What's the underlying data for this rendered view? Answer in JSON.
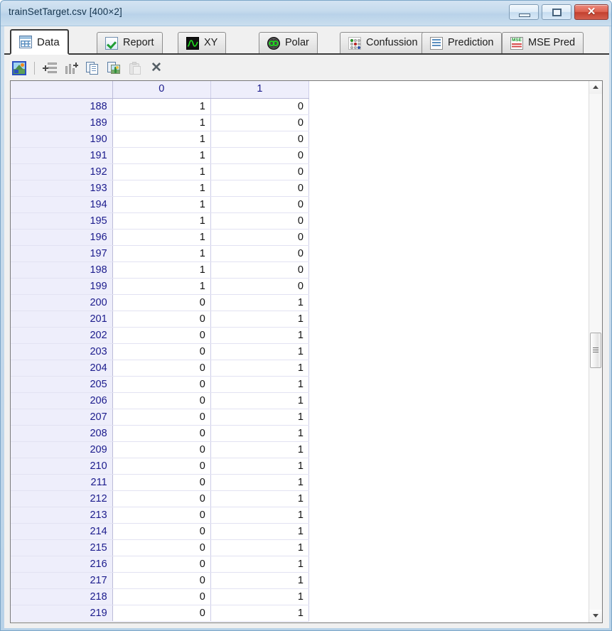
{
  "window": {
    "title": "trainSetTarget.csv [400×2]",
    "controls": [
      {
        "name": "minimize",
        "label": "–"
      },
      {
        "name": "maximize",
        "label": "□"
      },
      {
        "name": "close",
        "label": "✕"
      }
    ]
  },
  "tabs": [
    {
      "label": "Data",
      "icon": "table-grid-icon",
      "active": true
    },
    {
      "label": "Report",
      "icon": "green-check-icon",
      "active": false
    },
    {
      "label": "XY",
      "icon": "sine-wave-icon",
      "active": false
    },
    {
      "label": "Polar",
      "icon": "polar-infinity-icon",
      "active": false
    },
    {
      "label": "Confussion",
      "icon": "confusion-dots-icon",
      "active": false
    },
    {
      "label": "Prediction",
      "icon": "prediction-grid-icon",
      "active": false
    },
    {
      "label": "MSE Pred",
      "icon": "mse-grid-icon",
      "active": false
    }
  ],
  "toolbar": {
    "buttons": [
      {
        "name": "export-image-button",
        "icon": "export-image-icon",
        "tooltip": "Export image",
        "enabled": true
      },
      {
        "name": "add-row-button",
        "icon": "add-row-icon",
        "tooltip": "Add row",
        "enabled": true
      },
      {
        "name": "add-column-button",
        "icon": "add-column-icon",
        "tooltip": "Add column",
        "enabled": true
      },
      {
        "name": "copy-button",
        "icon": "copy-icon",
        "tooltip": "Copy",
        "enabled": true
      },
      {
        "name": "copy-image-button",
        "icon": "copy-image-icon",
        "tooltip": "Copy as image",
        "enabled": true
      },
      {
        "name": "paste-button",
        "icon": "paste-icon",
        "tooltip": "Paste",
        "enabled": false
      },
      {
        "name": "delete-button",
        "icon": "delete-x-icon",
        "tooltip": "Delete",
        "enabled": true
      }
    ],
    "delete_glyph": "✕"
  },
  "grid": {
    "corner_label": "",
    "columns": [
      "0",
      "1"
    ],
    "rows": [
      {
        "index": "188",
        "values": [
          "1",
          "0"
        ]
      },
      {
        "index": "189",
        "values": [
          "1",
          "0"
        ]
      },
      {
        "index": "190",
        "values": [
          "1",
          "0"
        ]
      },
      {
        "index": "191",
        "values": [
          "1",
          "0"
        ]
      },
      {
        "index": "192",
        "values": [
          "1",
          "0"
        ]
      },
      {
        "index": "193",
        "values": [
          "1",
          "0"
        ]
      },
      {
        "index": "194",
        "values": [
          "1",
          "0"
        ]
      },
      {
        "index": "195",
        "values": [
          "1",
          "0"
        ]
      },
      {
        "index": "196",
        "values": [
          "1",
          "0"
        ]
      },
      {
        "index": "197",
        "values": [
          "1",
          "0"
        ]
      },
      {
        "index": "198",
        "values": [
          "1",
          "0"
        ]
      },
      {
        "index": "199",
        "values": [
          "1",
          "0"
        ]
      },
      {
        "index": "200",
        "values": [
          "0",
          "1"
        ]
      },
      {
        "index": "201",
        "values": [
          "0",
          "1"
        ]
      },
      {
        "index": "202",
        "values": [
          "0",
          "1"
        ]
      },
      {
        "index": "203",
        "values": [
          "0",
          "1"
        ]
      },
      {
        "index": "204",
        "values": [
          "0",
          "1"
        ]
      },
      {
        "index": "205",
        "values": [
          "0",
          "1"
        ]
      },
      {
        "index": "206",
        "values": [
          "0",
          "1"
        ]
      },
      {
        "index": "207",
        "values": [
          "0",
          "1"
        ]
      },
      {
        "index": "208",
        "values": [
          "0",
          "1"
        ]
      },
      {
        "index": "209",
        "values": [
          "0",
          "1"
        ]
      },
      {
        "index": "210",
        "values": [
          "0",
          "1"
        ]
      },
      {
        "index": "211",
        "values": [
          "0",
          "1"
        ]
      },
      {
        "index": "212",
        "values": [
          "0",
          "1"
        ]
      },
      {
        "index": "213",
        "values": [
          "0",
          "1"
        ]
      },
      {
        "index": "214",
        "values": [
          "0",
          "1"
        ]
      },
      {
        "index": "215",
        "values": [
          "0",
          "1"
        ]
      },
      {
        "index": "216",
        "values": [
          "0",
          "1"
        ]
      },
      {
        "index": "217",
        "values": [
          "0",
          "1"
        ]
      },
      {
        "index": "218",
        "values": [
          "0",
          "1"
        ]
      },
      {
        "index": "219",
        "values": [
          "0",
          "1"
        ]
      }
    ]
  },
  "scrollbar": {
    "up_arrow": "▲",
    "down_arrow": "▼"
  },
  "colors": {
    "title_text": "#13334d",
    "header_bg": "#eeeefb",
    "header_text": "#1b1b8c",
    "cell_text": "#111111",
    "frame": "#7ca6c8",
    "close_button": "#c2402f"
  }
}
